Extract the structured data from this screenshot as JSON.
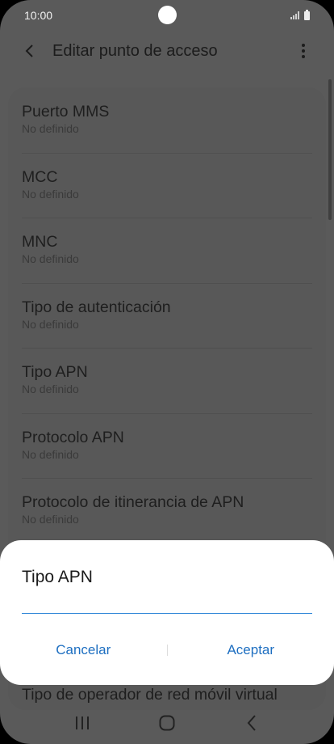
{
  "status_bar": {
    "time": "10:00"
  },
  "header": {
    "title": "Editar punto de acceso",
    "back_icon": "chevron-left-icon",
    "more_icon": "more-vertical-icon"
  },
  "settings": [
    {
      "title": "Puerto MMS",
      "value": "No definido"
    },
    {
      "title": "MCC",
      "value": "No definido"
    },
    {
      "title": "MNC",
      "value": "No definido"
    },
    {
      "title": "Tipo de autenticación",
      "value": "No definido"
    },
    {
      "title": "Tipo APN",
      "value": "No definido"
    },
    {
      "title": "Protocolo APN",
      "value": "No definido"
    },
    {
      "title": "Protocolo de itinerancia de APN",
      "value": "No definido"
    }
  ],
  "partial_item": {
    "title": "Tipo de operador de red móvil virtual"
  },
  "dialog": {
    "title": "Tipo APN",
    "input_value": "",
    "cancel_label": "Cancelar",
    "accept_label": "Aceptar",
    "accent_color": "#2f86d8"
  },
  "nav_bar": {
    "recents_icon": "recents-icon",
    "home_icon": "home-icon",
    "back_icon": "back-icon"
  }
}
